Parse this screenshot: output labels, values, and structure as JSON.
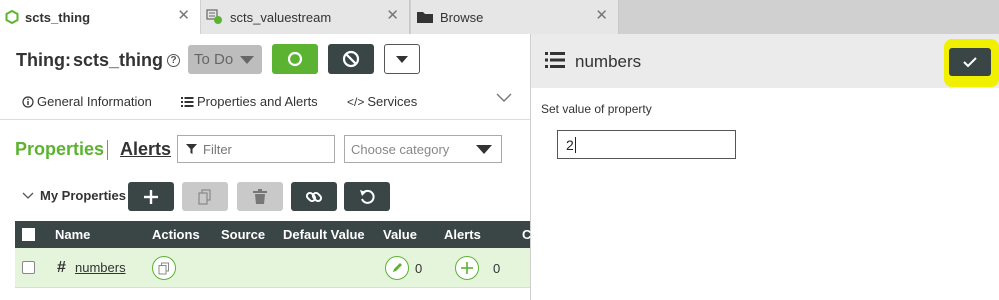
{
  "tabs": [
    {
      "label": "scts_thing",
      "icon": "thing-hexagon-icon",
      "active": true
    },
    {
      "label": "scts_valuestream",
      "icon": "valuestream-icon",
      "active": false
    },
    {
      "label": "Browse",
      "icon": "folder-icon",
      "active": false
    }
  ],
  "entity": {
    "type_label": "Thing:",
    "name": "scts_thing",
    "help_glyph": "?"
  },
  "header_buttons": {
    "state_label": "To Do"
  },
  "subtabs": [
    {
      "label": "General Information",
      "icon": "info-icon"
    },
    {
      "label": "Properties and Alerts",
      "icon": "list-icon",
      "selected": true
    },
    {
      "label": "Services",
      "icon": "code-icon"
    }
  ],
  "section": {
    "properties_label": "Properties",
    "alerts_label": "Alerts",
    "filter_placeholder": "Filter",
    "category_placeholder": "Choose category",
    "group_label": "My Properties"
  },
  "table": {
    "columns": [
      "Name",
      "Actions",
      "Source",
      "Default Value",
      "Value",
      "Alerts",
      "C"
    ],
    "rows": [
      {
        "name": "numbers",
        "value_count": "0",
        "alerts_count": "0"
      }
    ]
  },
  "side_panel": {
    "title": "numbers",
    "field_label": "Set value of property",
    "field_value": "2"
  },
  "colors": {
    "accent_green": "#5cb331",
    "dark_button": "#3a4646",
    "highlight": "#f0f000"
  }
}
